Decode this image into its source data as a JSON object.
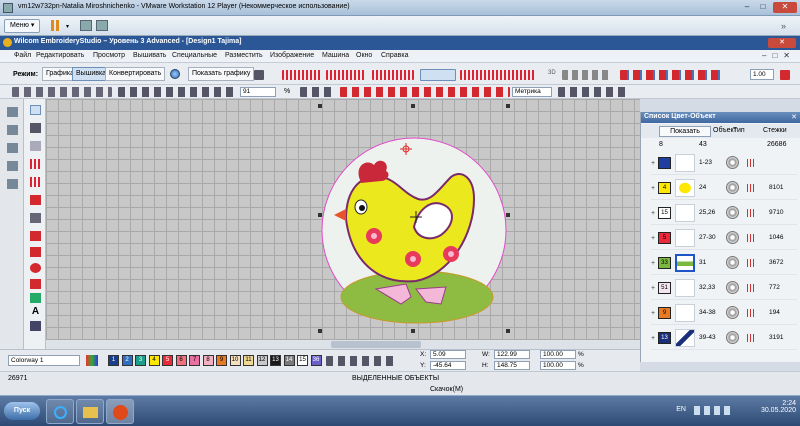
{
  "vmware": {
    "title": "vm12w732pn-Natalia Miroshnichenko - VMware Workstation 12 Player (Некоммерческое использование)",
    "menu_label": "Меню"
  },
  "app": {
    "title": "Wilcom EmbroideryStudio – Уровень 3 Advanced - [Design1        Tajima]"
  },
  "menubar": [
    "Файл",
    "Редактировать",
    "Просмотр",
    "Вышивать",
    "Специальные",
    "Разместить",
    "Изображение",
    "Машина",
    "Окно",
    "Справка"
  ],
  "toolbar": {
    "mode_label": "Режим:",
    "graphics_label": "Графика",
    "embroidery_label": "Вышивка",
    "convert_label": "Конвертировать",
    "show_graphics_label": "Показать графику",
    "zoom_value": "91",
    "zoom_unit": "%",
    "units_value": "Метрика",
    "scale_value": "1.00"
  },
  "panel": {
    "title": "Список Цвет-Объект",
    "show_button": "Показать",
    "col_object": "Объект",
    "col_type": "Тип",
    "col_stitches": "Стежки",
    "summary": {
      "colors": "8",
      "objects": "43",
      "stitches": "26686"
    },
    "rows": [
      {
        "swatch": "",
        "swatch_color": "#1f3fa0",
        "range": "1-23",
        "stitches": ""
      },
      {
        "swatch": "4",
        "swatch_color": "#ffe800",
        "range": "24",
        "stitches": "8101"
      },
      {
        "swatch": "15",
        "swatch_color": "#ffffff",
        "range": "25,26",
        "stitches": "9710"
      },
      {
        "swatch": "5",
        "swatch_color": "#e82a3a",
        "range": "27-30",
        "stitches": "1046"
      },
      {
        "swatch": "33",
        "swatch_color": "#7bb840",
        "range": "31",
        "stitches": "3672"
      },
      {
        "swatch": "51",
        "swatch_color": "#f3e4f0",
        "range": "32,33",
        "stitches": "772"
      },
      {
        "swatch": "9",
        "swatch_color": "#e87a24",
        "range": "34-38",
        "stitches": "194"
      },
      {
        "swatch": "13",
        "swatch_color": "#1a2f7a",
        "range": "39-43",
        "stitches": "3191"
      }
    ]
  },
  "colorway": {
    "selected": "Colorway 1",
    "chips": [
      {
        "n": "1",
        "c": "#1a3f8a"
      },
      {
        "n": "2",
        "c": "#2f6fc0"
      },
      {
        "n": "3",
        "c": "#1c9f8a"
      },
      {
        "n": "4",
        "c": "#ffe800"
      },
      {
        "n": "5",
        "c": "#e82a3a"
      },
      {
        "n": "6",
        "c": "#f07080"
      },
      {
        "n": "7",
        "c": "#e870a0"
      },
      {
        "n": "8",
        "c": "#f3b0c0"
      },
      {
        "n": "9",
        "c": "#e87a24"
      },
      {
        "n": "10",
        "c": "#f5e0c0"
      },
      {
        "n": "11",
        "c": "#f0d890"
      },
      {
        "n": "12",
        "c": "#c8c8c8"
      },
      {
        "n": "13",
        "c": "#1a1a1a"
      },
      {
        "n": "14",
        "c": "#7a7a7a"
      },
      {
        "n": "15",
        "c": "#ffffff"
      },
      {
        "n": "36",
        "c": "#6a60c8"
      }
    ]
  },
  "coords": {
    "x_label": "X:",
    "x_value": "5.09",
    "y_label": "Y:",
    "y_value": "-45.64",
    "w_label": "W:",
    "w_value": "122.99",
    "h_label": "H:",
    "h_value": "148.75",
    "sx_value": "100.00",
    "sy_value": "100.00",
    "pct": "%"
  },
  "status": {
    "stitch_count": "26971",
    "selection": "ВЫДЕЛЕННЫЕ ОБЪЕКТЫ",
    "jump": "Скачок(М)"
  },
  "taskbar": {
    "start": "Пуск",
    "lang": "EN",
    "time": "2:24",
    "date": "30.05.2020"
  }
}
